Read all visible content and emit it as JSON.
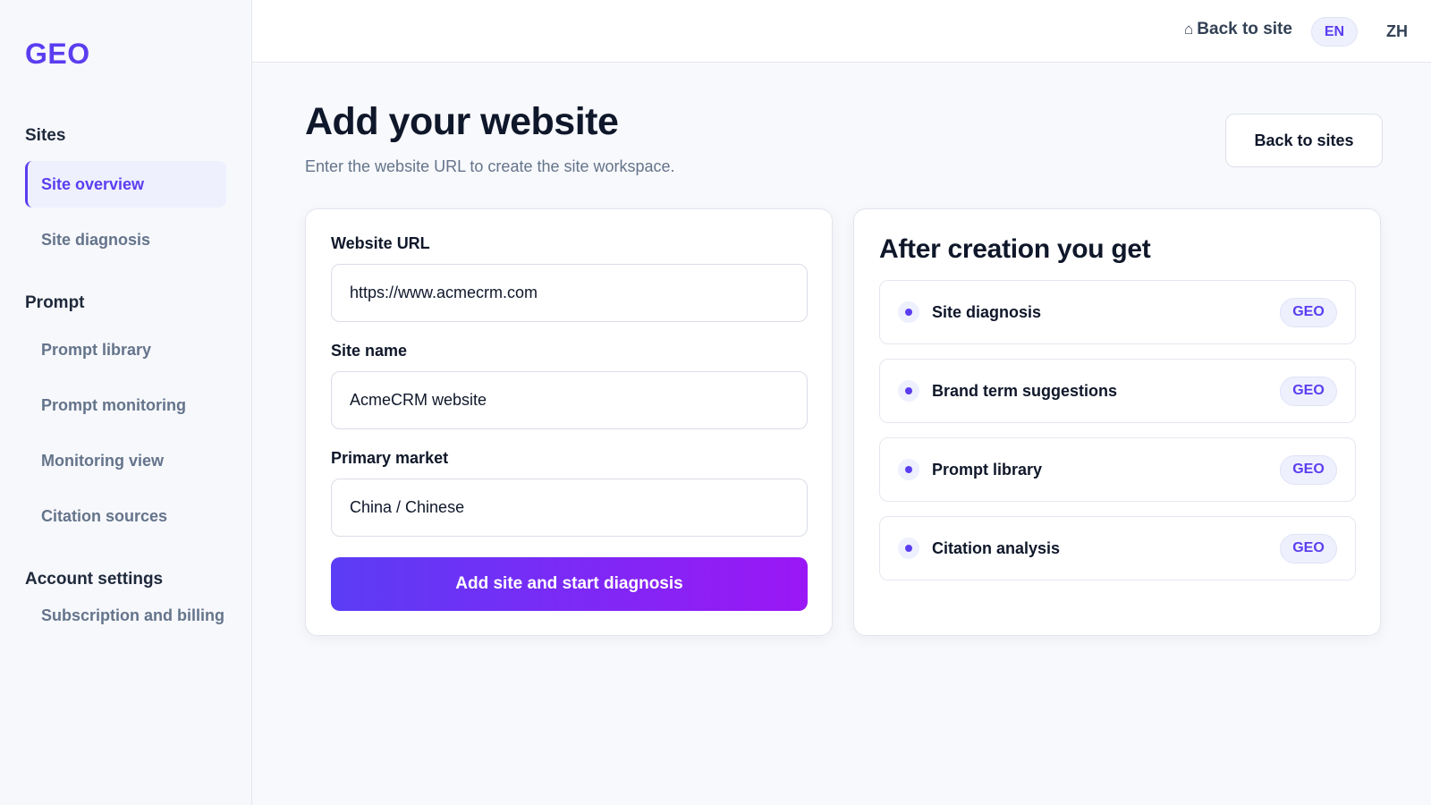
{
  "brand": {
    "logo": "GEO",
    "accent": "#5b3df0"
  },
  "sidebar": {
    "sections": [
      {
        "title": "Sites",
        "items": [
          {
            "label": "Site overview",
            "active": true
          },
          {
            "label": "Site diagnosis",
            "active": false
          }
        ]
      },
      {
        "title": "Prompt",
        "items": [
          {
            "label": "Prompt library",
            "active": false
          },
          {
            "label": "Prompt monitoring",
            "active": false
          },
          {
            "label": "Monitoring view",
            "active": false
          },
          {
            "label": "Citation sources",
            "active": false
          }
        ]
      },
      {
        "title": "Account settings",
        "items": [
          {
            "label": "Subscription and billing",
            "active": false
          }
        ]
      }
    ]
  },
  "topbar": {
    "back_to_site": "Back to site",
    "home_icon": "home-icon",
    "languages": [
      {
        "code": "EN",
        "active": true
      },
      {
        "code": "ZH",
        "active": false
      }
    ]
  },
  "page": {
    "title": "Add your website",
    "subtitle": "Enter the website URL to create the site workspace.",
    "back_to_sites": "Back to sites"
  },
  "form": {
    "url": {
      "label": "Website URL",
      "value": "https://www.acmecrm.com"
    },
    "name": {
      "label": "Site name",
      "value": "AcmeCRM website"
    },
    "market": {
      "label": "Primary market",
      "value": "China / Chinese"
    },
    "submit_label": "Add site and start diagnosis"
  },
  "info": {
    "title": "After creation you get",
    "features": [
      {
        "label": "Site diagnosis",
        "badge": "GEO"
      },
      {
        "label": "Brand term suggestions",
        "badge": "GEO"
      },
      {
        "label": "Prompt library",
        "badge": "GEO"
      },
      {
        "label": "Citation analysis",
        "badge": "GEO"
      }
    ]
  }
}
